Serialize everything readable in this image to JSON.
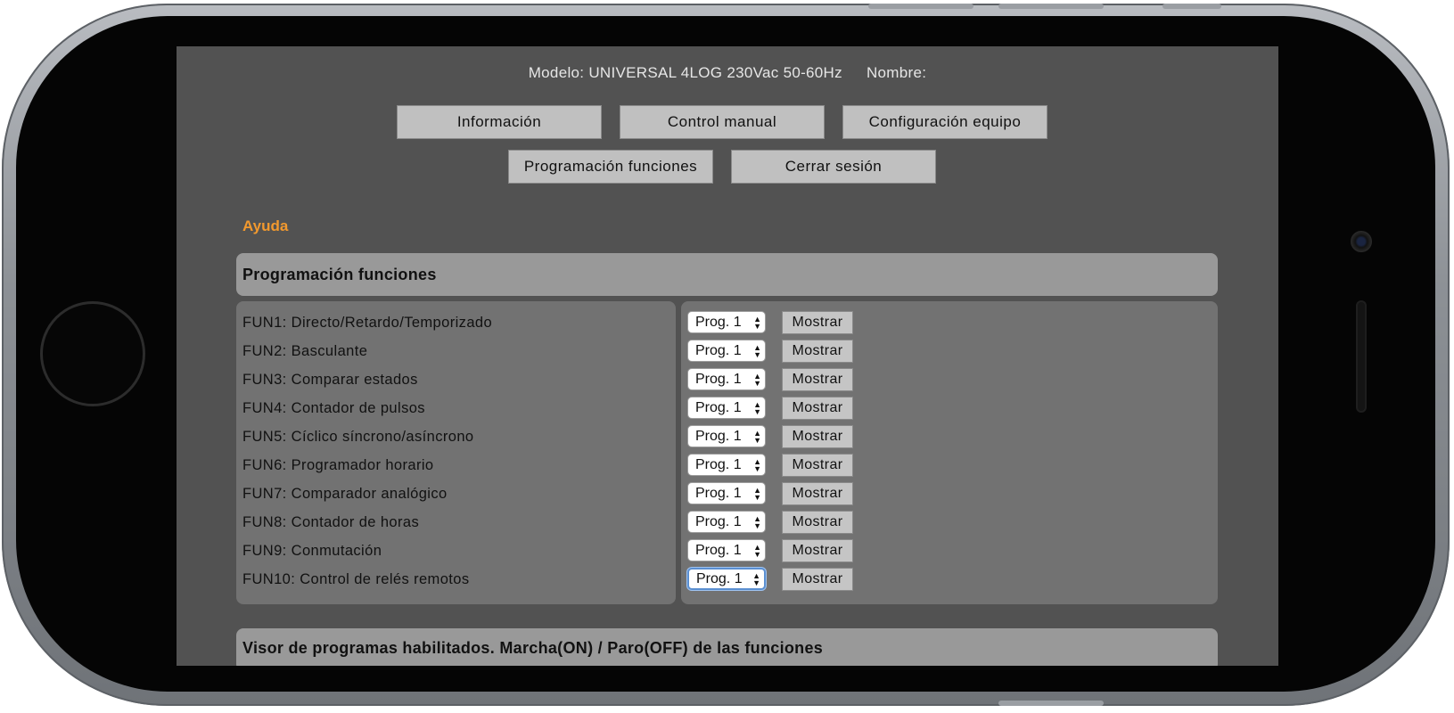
{
  "header": {
    "model": "Modelo: UNIVERSAL 4LOG 230Vac 50-60Hz",
    "name": "Nombre:"
  },
  "nav": {
    "info": "Información",
    "manual": "Control manual",
    "config": "Configuración equipo",
    "programming": "Programación funciones",
    "logout": "Cerrar sesión"
  },
  "help_label": "Ayuda",
  "section_title": "Programación funciones",
  "functions": [
    {
      "label": "FUN1: Directo/Retardo/Temporizado",
      "prog": "Prog. 1",
      "action": "Mostrar"
    },
    {
      "label": "FUN2: Basculante",
      "prog": "Prog. 1",
      "action": "Mostrar"
    },
    {
      "label": "FUN3: Comparar estados",
      "prog": "Prog. 1",
      "action": "Mostrar"
    },
    {
      "label": "FUN4: Contador de pulsos",
      "prog": "Prog. 1",
      "action": "Mostrar"
    },
    {
      "label": "FUN5: Cíclico síncrono/asíncrono",
      "prog": "Prog. 1",
      "action": "Mostrar"
    },
    {
      "label": "FUN6: Programador horario",
      "prog": "Prog. 1",
      "action": "Mostrar"
    },
    {
      "label": "FUN7: Comparador analógico",
      "prog": "Prog. 1",
      "action": "Mostrar"
    },
    {
      "label": "FUN8: Contador de horas",
      "prog": "Prog. 1",
      "action": "Mostrar"
    },
    {
      "label": "FUN9: Conmutación",
      "prog": "Prog. 1",
      "action": "Mostrar"
    },
    {
      "label": "FUN10: Control de relés remotos",
      "prog": "Prog. 1",
      "action": "Mostrar"
    }
  ],
  "viewer_title": "Visor de programas habilitados. Marcha(ON) / Paro(OFF) de las funciones",
  "colors": {
    "screen_bg": "#525252",
    "panel_bg": "#727272",
    "header_bg": "#999999",
    "button_bg": "#c0c0c0",
    "help_link": "#f2992e"
  }
}
